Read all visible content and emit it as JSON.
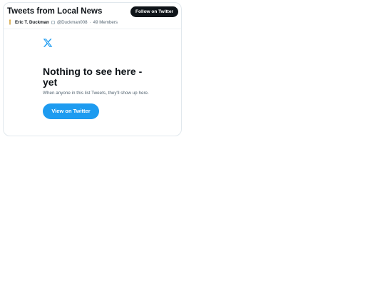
{
  "header": {
    "title": "Tweets from Local News",
    "follow_label": "Follow on Twitter",
    "owner_name": "Eric T. Duckman",
    "owner_handle": "@Duckman008",
    "separator": "·",
    "members": "49 Members"
  },
  "empty_state": {
    "icon": "x-logo-icon",
    "title": "Nothing to see here - yet",
    "subtitle": "When anyone in this list Tweets, they'll show up here.",
    "button_label": "View on Twitter"
  },
  "colors": {
    "accent": "#1d9bf0",
    "follow_button": "#0f1419",
    "text_primary": "#0f1419",
    "text_secondary": "#536471",
    "border": "#e1e8ed"
  }
}
